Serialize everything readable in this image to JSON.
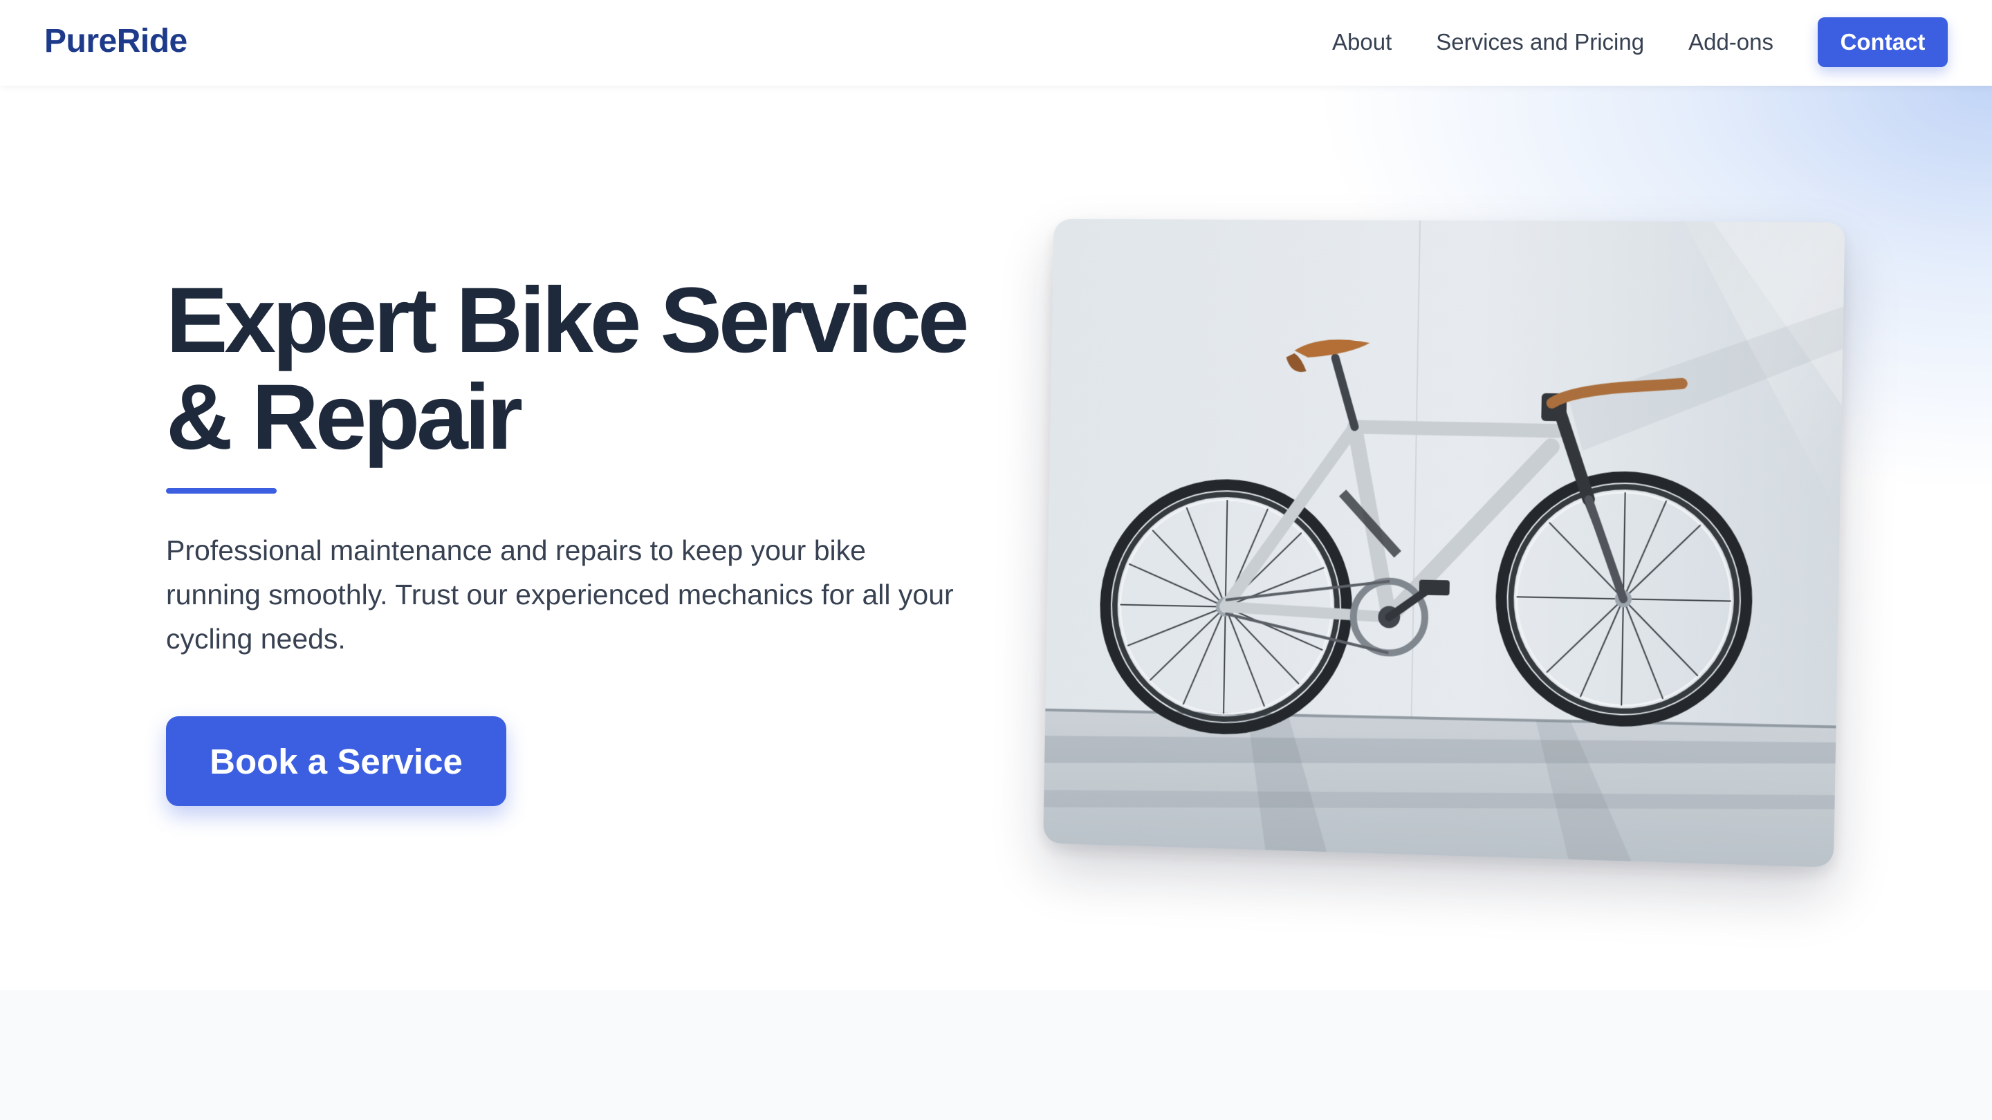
{
  "brand": {
    "name": "PureRide",
    "color": "#1e3a8a",
    "accent": "#3b5fe0"
  },
  "nav": {
    "links": [
      {
        "label": "About"
      },
      {
        "label": "Services and Pricing"
      },
      {
        "label": "Add-ons"
      }
    ],
    "contact_label": "Contact"
  },
  "hero": {
    "title": "Expert Bike Service & Repair",
    "subtitle": "Professional maintenance and repairs to keep your bike running smoothly. Trust our experienced mechanics for all your cycling needs.",
    "cta_label": "Book a Service",
    "image_name": "bicycle-photo"
  },
  "colors": {
    "heading": "#1e293b",
    "body_text": "#374151",
    "section_bg": "#f8fafc"
  }
}
